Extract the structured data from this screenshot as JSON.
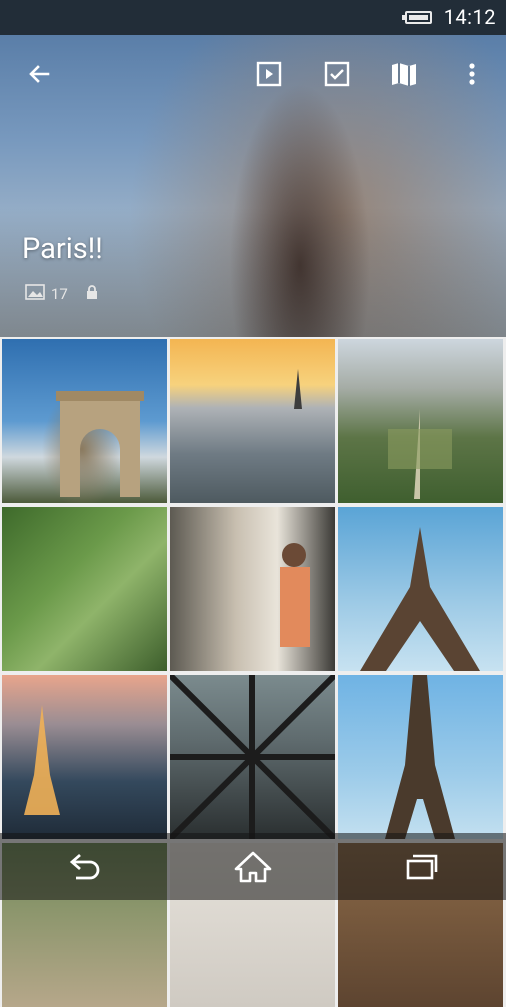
{
  "status": {
    "time": "14:12"
  },
  "album": {
    "title": "Paris!!",
    "photo_count": "17"
  },
  "toolbar": {
    "icons": [
      "back-arrow-icon",
      "slideshow-icon",
      "select-icon",
      "map-icon",
      "overflow-menu-icon"
    ]
  },
  "photos": [
    {
      "subject": "arc-de-triomphe"
    },
    {
      "subject": "eiffel-tower-sunset-skyline"
    },
    {
      "subject": "champ-de-mars-aerial"
    },
    {
      "subject": "park-aerial-green"
    },
    {
      "subject": "cafe-woman"
    },
    {
      "subject": "eiffel-tower-base"
    },
    {
      "subject": "eiffel-tower-night-lights"
    },
    {
      "subject": "eiffel-tower-ironwork"
    },
    {
      "subject": "eiffel-tower-full"
    },
    {
      "subject": "street-crowd"
    },
    {
      "subject": "building-facade"
    },
    {
      "subject": "tower-arches"
    }
  ],
  "navbar": {
    "icons": [
      "back-icon",
      "home-icon",
      "recent-apps-icon"
    ]
  }
}
